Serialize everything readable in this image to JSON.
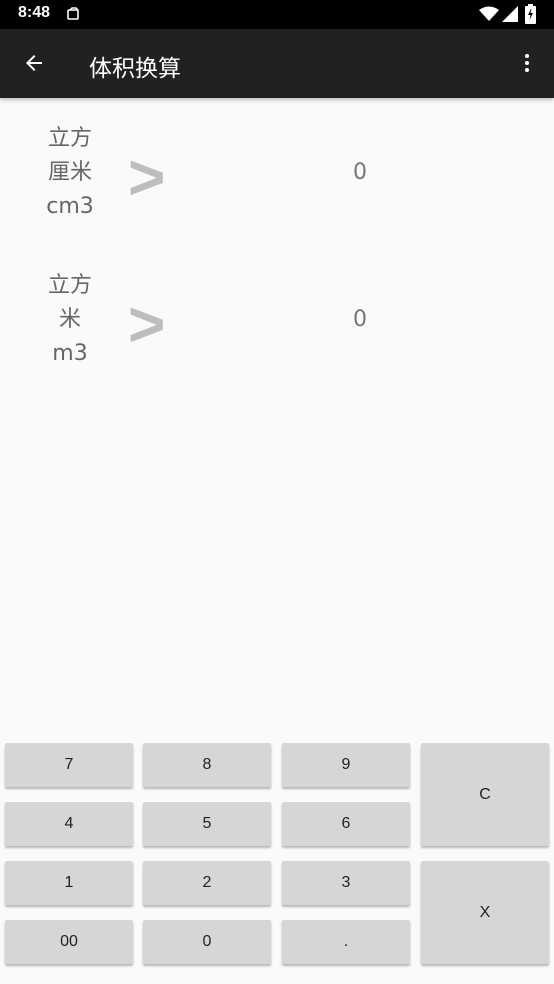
{
  "status_bar": {
    "time": "8:48",
    "icons": [
      "notification-icon",
      "wifi-icon",
      "signal-icon",
      "battery-icon"
    ]
  },
  "toolbar": {
    "title": "体积换算",
    "back_icon": "back-arrow-icon",
    "menu_icon": "more-vertical-icon"
  },
  "units": [
    {
      "line1": "立方",
      "line2": "厘米",
      "line3": "cm3",
      "arrow": ">",
      "value": "0"
    },
    {
      "line1": "立方",
      "line2": "米",
      "line3": "m3",
      "arrow": ">",
      "value": "0"
    }
  ],
  "keypad": {
    "k7": "7",
    "k8": "8",
    "k9": "9",
    "k4": "4",
    "k5": "5",
    "k6": "6",
    "k1": "1",
    "k2": "2",
    "k3": "3",
    "k00": "00",
    "k0": "0",
    "kdot": ".",
    "clear": "C",
    "delete": "X"
  },
  "colors": {
    "toolbar_bg": "#212121",
    "status_bg": "#000000",
    "page_bg": "#fafafa",
    "key_bg": "#d6d6d6",
    "arrow": "#bdbdbd"
  }
}
